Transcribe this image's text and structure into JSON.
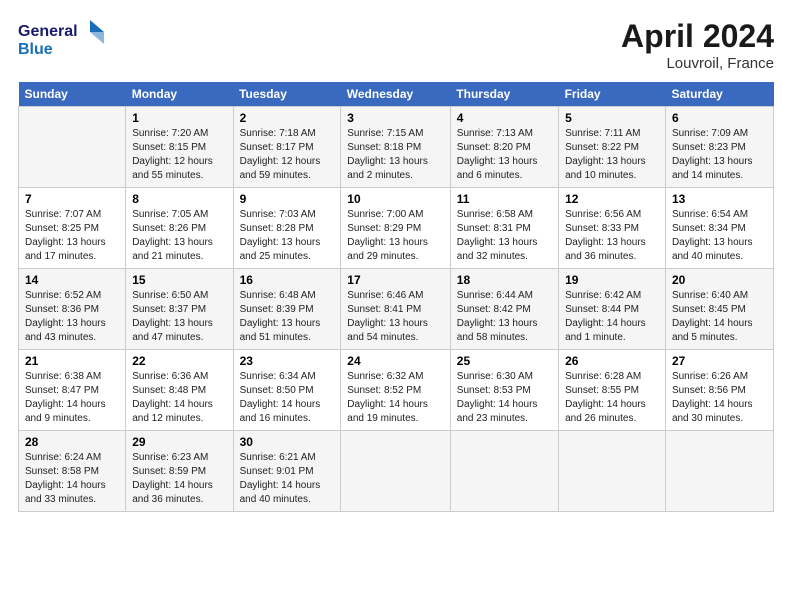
{
  "header": {
    "logo_line1": "General",
    "logo_line2": "Blue",
    "month": "April 2024",
    "location": "Louvroil, France"
  },
  "weekdays": [
    "Sunday",
    "Monday",
    "Tuesday",
    "Wednesday",
    "Thursday",
    "Friday",
    "Saturday"
  ],
  "weeks": [
    [
      {
        "num": "",
        "info": ""
      },
      {
        "num": "1",
        "info": "Sunrise: 7:20 AM\nSunset: 8:15 PM\nDaylight: 12 hours\nand 55 minutes."
      },
      {
        "num": "2",
        "info": "Sunrise: 7:18 AM\nSunset: 8:17 PM\nDaylight: 12 hours\nand 59 minutes."
      },
      {
        "num": "3",
        "info": "Sunrise: 7:15 AM\nSunset: 8:18 PM\nDaylight: 13 hours\nand 2 minutes."
      },
      {
        "num": "4",
        "info": "Sunrise: 7:13 AM\nSunset: 8:20 PM\nDaylight: 13 hours\nand 6 minutes."
      },
      {
        "num": "5",
        "info": "Sunrise: 7:11 AM\nSunset: 8:22 PM\nDaylight: 13 hours\nand 10 minutes."
      },
      {
        "num": "6",
        "info": "Sunrise: 7:09 AM\nSunset: 8:23 PM\nDaylight: 13 hours\nand 14 minutes."
      }
    ],
    [
      {
        "num": "7",
        "info": "Sunrise: 7:07 AM\nSunset: 8:25 PM\nDaylight: 13 hours\nand 17 minutes."
      },
      {
        "num": "8",
        "info": "Sunrise: 7:05 AM\nSunset: 8:26 PM\nDaylight: 13 hours\nand 21 minutes."
      },
      {
        "num": "9",
        "info": "Sunrise: 7:03 AM\nSunset: 8:28 PM\nDaylight: 13 hours\nand 25 minutes."
      },
      {
        "num": "10",
        "info": "Sunrise: 7:00 AM\nSunset: 8:29 PM\nDaylight: 13 hours\nand 29 minutes."
      },
      {
        "num": "11",
        "info": "Sunrise: 6:58 AM\nSunset: 8:31 PM\nDaylight: 13 hours\nand 32 minutes."
      },
      {
        "num": "12",
        "info": "Sunrise: 6:56 AM\nSunset: 8:33 PM\nDaylight: 13 hours\nand 36 minutes."
      },
      {
        "num": "13",
        "info": "Sunrise: 6:54 AM\nSunset: 8:34 PM\nDaylight: 13 hours\nand 40 minutes."
      }
    ],
    [
      {
        "num": "14",
        "info": "Sunrise: 6:52 AM\nSunset: 8:36 PM\nDaylight: 13 hours\nand 43 minutes."
      },
      {
        "num": "15",
        "info": "Sunrise: 6:50 AM\nSunset: 8:37 PM\nDaylight: 13 hours\nand 47 minutes."
      },
      {
        "num": "16",
        "info": "Sunrise: 6:48 AM\nSunset: 8:39 PM\nDaylight: 13 hours\nand 51 minutes."
      },
      {
        "num": "17",
        "info": "Sunrise: 6:46 AM\nSunset: 8:41 PM\nDaylight: 13 hours\nand 54 minutes."
      },
      {
        "num": "18",
        "info": "Sunrise: 6:44 AM\nSunset: 8:42 PM\nDaylight: 13 hours\nand 58 minutes."
      },
      {
        "num": "19",
        "info": "Sunrise: 6:42 AM\nSunset: 8:44 PM\nDaylight: 14 hours\nand 1 minute."
      },
      {
        "num": "20",
        "info": "Sunrise: 6:40 AM\nSunset: 8:45 PM\nDaylight: 14 hours\nand 5 minutes."
      }
    ],
    [
      {
        "num": "21",
        "info": "Sunrise: 6:38 AM\nSunset: 8:47 PM\nDaylight: 14 hours\nand 9 minutes."
      },
      {
        "num": "22",
        "info": "Sunrise: 6:36 AM\nSunset: 8:48 PM\nDaylight: 14 hours\nand 12 minutes."
      },
      {
        "num": "23",
        "info": "Sunrise: 6:34 AM\nSunset: 8:50 PM\nDaylight: 14 hours\nand 16 minutes."
      },
      {
        "num": "24",
        "info": "Sunrise: 6:32 AM\nSunset: 8:52 PM\nDaylight: 14 hours\nand 19 minutes."
      },
      {
        "num": "25",
        "info": "Sunrise: 6:30 AM\nSunset: 8:53 PM\nDaylight: 14 hours\nand 23 minutes."
      },
      {
        "num": "26",
        "info": "Sunrise: 6:28 AM\nSunset: 8:55 PM\nDaylight: 14 hours\nand 26 minutes."
      },
      {
        "num": "27",
        "info": "Sunrise: 6:26 AM\nSunset: 8:56 PM\nDaylight: 14 hours\nand 30 minutes."
      }
    ],
    [
      {
        "num": "28",
        "info": "Sunrise: 6:24 AM\nSunset: 8:58 PM\nDaylight: 14 hours\nand 33 minutes."
      },
      {
        "num": "29",
        "info": "Sunrise: 6:23 AM\nSunset: 8:59 PM\nDaylight: 14 hours\nand 36 minutes."
      },
      {
        "num": "30",
        "info": "Sunrise: 6:21 AM\nSunset: 9:01 PM\nDaylight: 14 hours\nand 40 minutes."
      },
      {
        "num": "",
        "info": ""
      },
      {
        "num": "",
        "info": ""
      },
      {
        "num": "",
        "info": ""
      },
      {
        "num": "",
        "info": ""
      }
    ]
  ]
}
